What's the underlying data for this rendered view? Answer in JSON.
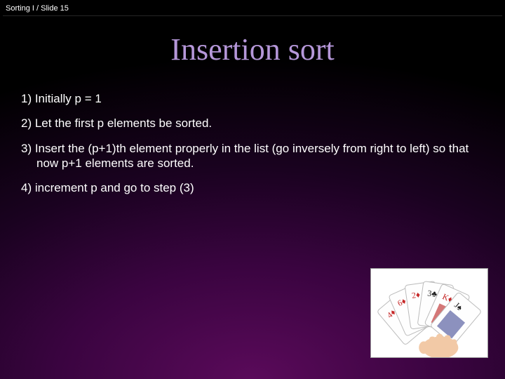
{
  "header": {
    "course": "Sorting I",
    "separator": "/",
    "slide_label": "Slide 15"
  },
  "title": "Insertion sort",
  "steps": [
    "1) Initially p = 1",
    "2) Let the first p elements be sorted.",
    "3) Insert the (p+1)th element properly in the list (go inversely from right to left) so that now p+1 elements are sorted.",
    "4) increment p and go to step (3)"
  ],
  "image": {
    "name": "hand-holding-playing-cards"
  }
}
